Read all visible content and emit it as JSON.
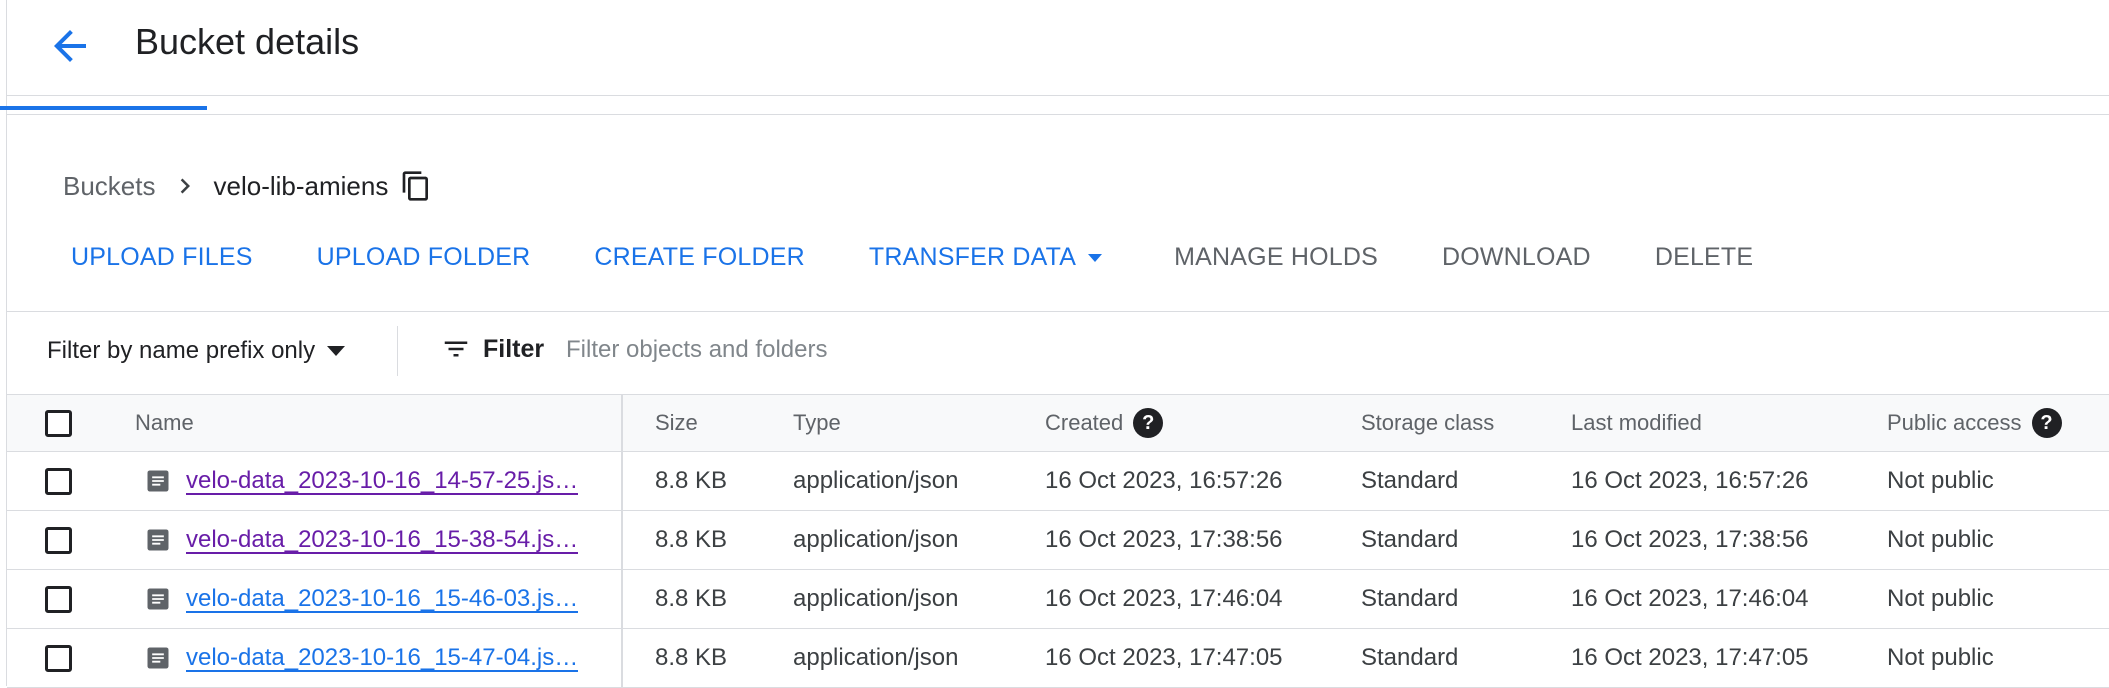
{
  "header": {
    "title": "Bucket details"
  },
  "breadcrumb": {
    "parent": "Buckets",
    "current": "velo-lib-amiens"
  },
  "toolbar": {
    "upload_files": "UPLOAD FILES",
    "upload_folder": "UPLOAD FOLDER",
    "create_folder": "CREATE FOLDER",
    "transfer_data": "TRANSFER DATA",
    "manage_holds": "MANAGE HOLDS",
    "download": "DOWNLOAD",
    "delete": "DELETE"
  },
  "filter": {
    "type_label": "Filter by name prefix only",
    "button_label": "Filter",
    "placeholder": "Filter objects and folders"
  },
  "table": {
    "headers": {
      "name": "Name",
      "size": "Size",
      "type": "Type",
      "created": "Created",
      "storage_class": "Storage class",
      "last_modified": "Last modified",
      "public_access": "Public access"
    },
    "help_glyph": "?",
    "rows": [
      {
        "name": "velo-data_2023-10-16_14-57-25.js…",
        "size": "8.8 KB",
        "type": "application/json",
        "created": "16 Oct 2023, 16:57:26",
        "storage_class": "Standard",
        "last_modified": "16 Oct 2023, 16:57:26",
        "public_access": "Not public",
        "visited": true
      },
      {
        "name": "velo-data_2023-10-16_15-38-54.js…",
        "size": "8.8 KB",
        "type": "application/json",
        "created": "16 Oct 2023, 17:38:56",
        "storage_class": "Standard",
        "last_modified": "16 Oct 2023, 17:38:56",
        "public_access": "Not public",
        "visited": true
      },
      {
        "name": "velo-data_2023-10-16_15-46-03.js…",
        "size": "8.8 KB",
        "type": "application/json",
        "created": "16 Oct 2023, 17:46:04",
        "storage_class": "Standard",
        "last_modified": "16 Oct 2023, 17:46:04",
        "public_access": "Not public",
        "visited": false
      },
      {
        "name": "velo-data_2023-10-16_15-47-04.js…",
        "size": "8.8 KB",
        "type": "application/json",
        "created": "16 Oct 2023, 17:47:05",
        "storage_class": "Standard",
        "last_modified": "16 Oct 2023, 17:47:05",
        "public_access": "Not public",
        "visited": false
      }
    ]
  },
  "colors": {
    "accent": "#1a73e8",
    "visited_link": "#681da8",
    "muted": "#5f6368",
    "border": "#dadce0"
  },
  "icons": {
    "back": "arrow-back-icon",
    "chevron": "chevron-right-icon",
    "copy": "copy-icon",
    "filter": "filter-list-icon",
    "file": "document-icon",
    "help": "help-icon"
  }
}
